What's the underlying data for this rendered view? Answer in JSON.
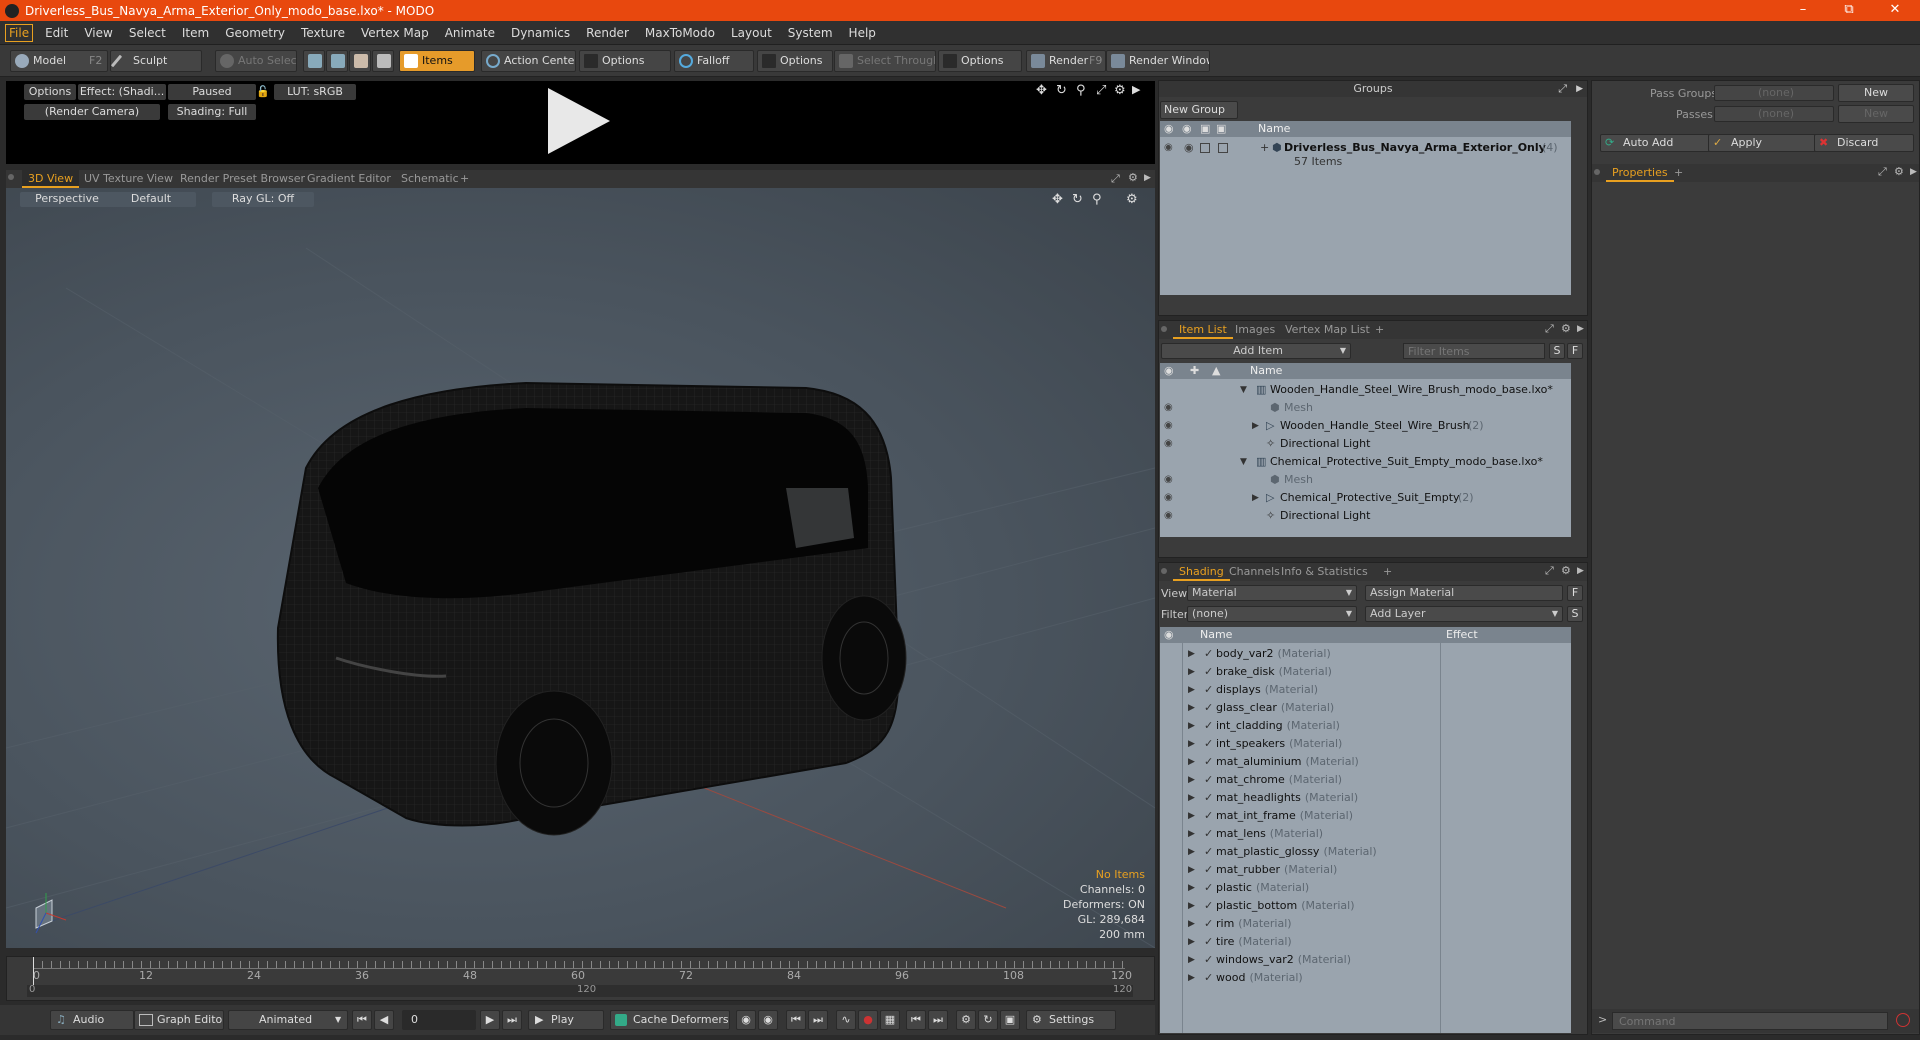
{
  "title": "Driverless_Bus_Navya_Arma_Exterior_Only_modo_base.lxo* - MODO",
  "menu": [
    "File",
    "Edit",
    "View",
    "Select",
    "Item",
    "Geometry",
    "Texture",
    "Vertex Map",
    "Animate",
    "Dynamics",
    "Render",
    "MaxToModo",
    "Layout",
    "System",
    "Help"
  ],
  "toolbar": {
    "model": "Model",
    "model_key": "F2",
    "sculpt": "Sculpt",
    "auto_select": "Auto Select",
    "items": "Items",
    "action_center": "Action Center",
    "options1": "Options",
    "falloff": "Falloff",
    "options2": "Options",
    "select_through": "Select Through",
    "options3": "Options",
    "render": "Render",
    "render_key": "F9",
    "render_window": "Render Window"
  },
  "preview": {
    "options": "Options",
    "effect": "Effect: (Shadi...",
    "paused": "Paused",
    "lut": "LUT: sRGB",
    "camera": "(Render Camera)",
    "shading": "Shading: Full"
  },
  "view_tabs": [
    "3D View",
    "UV Texture View",
    "Render Preset Browser",
    "Gradient Editor",
    "Schematic",
    "+"
  ],
  "viewport": {
    "perspective": "Perspective",
    "default": "Default",
    "raygl": "Ray GL: Off",
    "info": {
      "items": "No Items",
      "channels": "Channels: 0",
      "deformers": "Deformers: ON",
      "gl": "GL: 289,684",
      "scale": "200 mm"
    }
  },
  "timeline": {
    "ticks": [
      "0",
      "12",
      "24",
      "36",
      "48",
      "60",
      "72",
      "84",
      "96",
      "108",
      "120"
    ],
    "start": "0",
    "end": "120",
    "mid": "120"
  },
  "bottom": {
    "audio": "Audio",
    "graph_editor": "Graph Editor",
    "animated": "Animated",
    "frame": "0",
    "play": "Play",
    "cache_deformers": "Cache Deformers",
    "settings": "Settings"
  },
  "groups": {
    "title": "Groups",
    "new_group": "New Group",
    "col_name": "Name",
    "item": {
      "name": "Driverless_Bus_Navya_Arma_Exterior_Only",
      "count": "(4)",
      "sub": "57 Items"
    }
  },
  "pass": {
    "pass_groups": "Pass Groups",
    "passes": "Passes",
    "none1": "(none)",
    "none2": "(none)",
    "new1": "New",
    "new2": "New",
    "auto_add": "Auto Add",
    "apply": "Apply",
    "discard": "Discard",
    "properties": "Properties",
    "plus": "+"
  },
  "itemlist": {
    "tabs": [
      "Item List",
      "Images",
      "Vertex Map List",
      "+"
    ],
    "add_item": "Add Item",
    "filter": "Filter Items",
    "s": "S",
    "f": "F",
    "col_name": "Name",
    "rows": [
      {
        "name": "Wooden_Handle_Steel_Wire_Brush_modo_base.lxo*",
        "extra": "",
        "indent": 0,
        "dim": false
      },
      {
        "name": "Mesh",
        "extra": "",
        "indent": 2,
        "dim": true
      },
      {
        "name": "Wooden_Handle_Steel_Wire_Brush",
        "extra": "(2)",
        "indent": 1,
        "dim": false
      },
      {
        "name": "Directional Light",
        "extra": "",
        "indent": 2,
        "dim": false
      },
      {
        "name": "Chemical_Protective_Suit_Empty_modo_base.lxo*",
        "extra": "",
        "indent": 0,
        "dim": false
      },
      {
        "name": "Mesh",
        "extra": "",
        "indent": 2,
        "dim": true
      },
      {
        "name": "Chemical_Protective_Suit_Empty",
        "extra": "(2)",
        "indent": 1,
        "dim": false
      },
      {
        "name": "Directional Light",
        "extra": "",
        "indent": 2,
        "dim": false
      }
    ]
  },
  "shading": {
    "tabs": [
      "Shading",
      "Channels",
      "Info & Statistics",
      "+"
    ],
    "view_label": "View",
    "view_value": "Material",
    "assign": "Assign Material",
    "f": "F",
    "filter_label": "Filter",
    "filter_value": "(none)",
    "add_layer": "Add Layer",
    "s": "S",
    "col_name": "Name",
    "col_effect": "Effect",
    "materials": [
      "body_var2",
      "brake_disk",
      "displays",
      "glass_clear",
      "int_cladding",
      "int_speakers",
      "mat_aluminium",
      "mat_chrome",
      "mat_headlights",
      "mat_int_frame",
      "mat_lens",
      "mat_plastic_glossy",
      "mat_rubber",
      "plastic",
      "plastic_bottom",
      "rim",
      "tire",
      "windows_var2",
      "wood"
    ],
    "mat_suffix": "(Material)"
  },
  "command_placeholder": "Command",
  "colors": {
    "accent": "#e8a020",
    "titlebar": "#e8480e"
  }
}
